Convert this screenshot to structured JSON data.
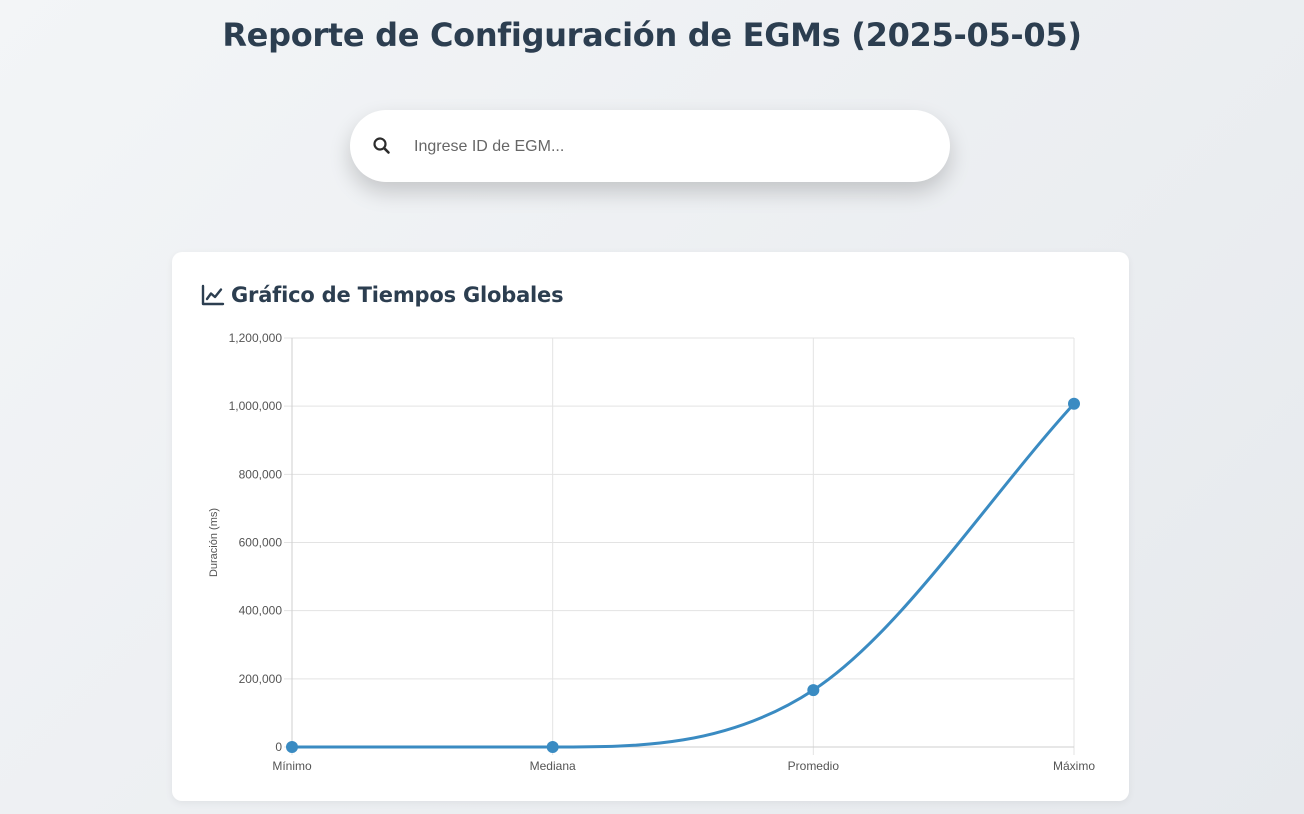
{
  "page": {
    "title": "Reporte de Configuración de EGMs (2025-05-05)"
  },
  "search": {
    "placeholder": "Ingrese ID de EGM...",
    "value": "",
    "icon": "search-icon"
  },
  "card": {
    "title": "Gráfico de Tiempos Globales",
    "icon": "chart-line-icon"
  },
  "colors": {
    "accent": "#3a8bc2",
    "title": "#2c3e50",
    "grid": "#e3e3e3"
  },
  "chart_data": {
    "type": "line",
    "categories": [
      "Mínimo",
      "Mediana",
      "Promedio",
      "Máximo"
    ],
    "series": [
      {
        "values": [
          0,
          0,
          167000,
          1007000
        ]
      }
    ],
    "ylabel": "Duración (ms)",
    "xlabel": "",
    "ylim": [
      0,
      1200000
    ],
    "yticks": [
      0,
      200000,
      400000,
      600000,
      800000,
      1000000,
      1200000
    ],
    "ytick_labels": [
      "0",
      "200,000",
      "400,000",
      "600,000",
      "800,000",
      "1,000,000",
      "1,200,000"
    ],
    "grid": true,
    "legend": "none",
    "smooth": true
  }
}
